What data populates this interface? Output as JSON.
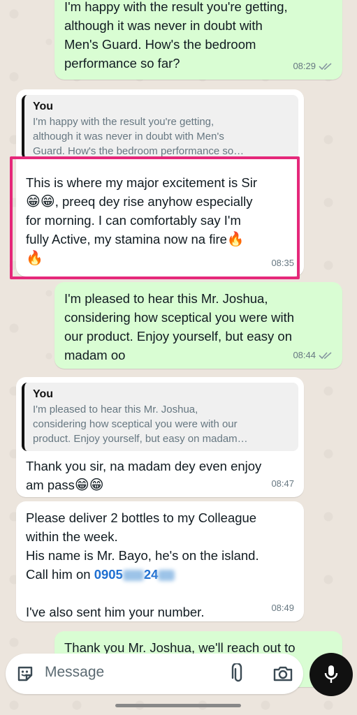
{
  "messages": [
    {
      "id": "m1",
      "text": "I'm happy with the result you're getting,\nalthough it was never in doubt with\nMen's Guard. How's the bedroom\nperformance so far?",
      "time": "08:29"
    },
    {
      "id": "m2",
      "quote_author": "You",
      "quote_text": "I'm happy with the result you're getting,\nalthough it was never in doubt with Men's\nGuard. How's the bedroom performance so…",
      "text_a": "This is where my major excitement is Sir",
      "text_b": ", preeq dey rise anyhow especially\nfor morning. I can comfortably say I'm\nfully Active, my stamina now na fire",
      "time": "08:35"
    },
    {
      "id": "m3",
      "text": "I'm pleased to hear this Mr. Joshua,\nconsidering how sceptical you were with\nour product. Enjoy yourself, but easy on\nmadam oo",
      "time": "08:44"
    },
    {
      "id": "m4",
      "quote_author": "You",
      "quote_text": "I'm pleased to hear this Mr. Joshua,\nconsidering how sceptical you were with our\nproduct. Enjoy yourself, but easy on madam…",
      "text": "Thank you sir, na madam dey even enjoy\nam pass",
      "time": "08:47"
    },
    {
      "id": "m5",
      "text_a": "Please deliver 2 bottles to my Colleague\nwithin the week.\nHis name is Mr. Bayo, he's on the island.\nCall him on ",
      "phone_a": "0905",
      "phone_b": "24",
      "text_b": "I've also sent him your number.",
      "time": "08:49"
    },
    {
      "id": "m6",
      "text": "Thank you Mr. Joshua, we'll reach out to"
    }
  ],
  "input": {
    "placeholder": "Message"
  },
  "icons": {
    "sticker": "sticker-icon",
    "attach": "paperclip-icon",
    "camera": "camera-icon",
    "mic": "microphone-icon",
    "read": "double-check-icon",
    "emoji_grin": "😁",
    "emoji_fire": "🔥"
  },
  "colors": {
    "outgoing": "#d9fdd3",
    "incoming": "#ffffff",
    "highlight": "#e5287a",
    "link": "#1f6fd1"
  }
}
